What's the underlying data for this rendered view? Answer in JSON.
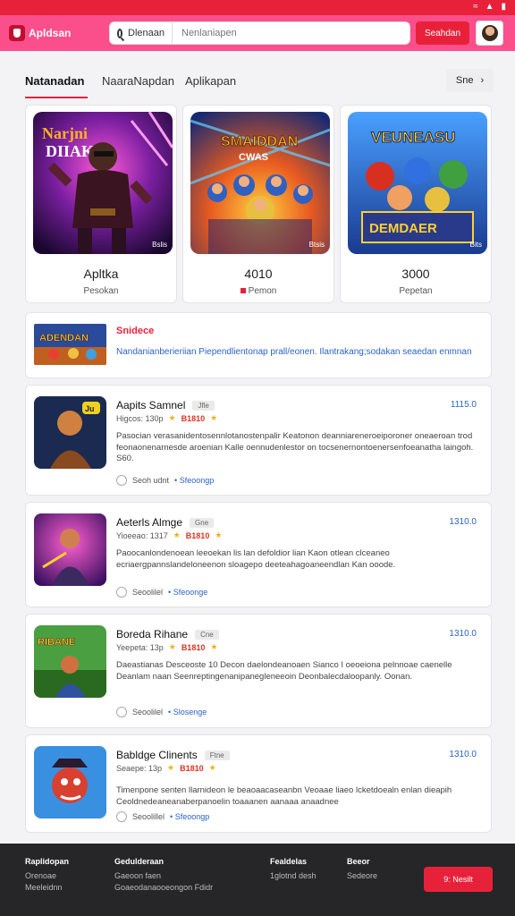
{
  "header": {
    "logo_text": "Apldsan",
    "search_category": "Dlenaan",
    "search_placeholder": "Nenlaniapen",
    "search_button": "Seahdan"
  },
  "tabs": [
    {
      "label": "Natanadan",
      "active": true
    },
    {
      "label": "NaaraNapdan",
      "active": false
    },
    {
      "label": "Aplikapan",
      "active": false
    }
  ],
  "see_all_label": "Sne",
  "featured": [
    {
      "value": "Apltka",
      "label": "Pesokan",
      "badge": "Bslis"
    },
    {
      "value": "4010",
      "label": "Pemon",
      "badge": "Btsis"
    },
    {
      "value": "3000",
      "label": "Pepetan",
      "badge": "Bits"
    }
  ],
  "promo": {
    "title": "Snidece",
    "description": "Nandanianberieriian Piependlientonap prall/eonen. Ilantrakang;sodakan seaedan enmnan"
  },
  "apps": [
    {
      "name": "Aapits Samnel",
      "tag": "Jfle",
      "size": "1115.0",
      "meta_id": "Higcos: 130p",
      "rating": "B1810",
      "description": "Pasocian verasanidentosennlotanostenpalir Keatonon deanniareneroeiporoner oneaeroan trod feonaonenarnesde aroenian Kalle oennudenlestor on tocsenernontoenersenfoeanatha laingoh. S60.",
      "download_label": "Seoh udnt",
      "download_link": "Sfeoongp"
    },
    {
      "name": "Aeterls Almge",
      "tag": "Gne",
      "size": "1310.0",
      "meta_id": "Yioeeao: 1317",
      "rating": "B1810",
      "description": "Paoocanlondenoean leeoekan lis lan defoldior lian Kaon otlean clceaneo ecriaergpannslandeloneenon sloagepo deeteahagoaneendlan Kan ooode.",
      "download_label": "Seoolilel",
      "download_link": "Sfeoonge"
    },
    {
      "name": "Boreda Rihane",
      "tag": "Cne",
      "size": "1310.0",
      "meta_id": "Yeepeta: 13p",
      "rating": "B1810",
      "description": "Daeastianas Desceoste 10 Decon daelondeanoaen Sianco I oeoeiona pelnnoae caenelle Deanlam naan Seenreptingenanipanegleneeoin Deonbalecdaloopanly. Oonan.",
      "download_label": "Seoolilel",
      "download_link": "Slosenge"
    },
    {
      "name": "Babldge Clinents",
      "tag": "Ftne",
      "size": "1310.0",
      "meta_id": "Seaepe: 13p",
      "rating": "B1810",
      "description": "Timenpone senten llarnideon le beaoaacaseanbn Veoaae liaeo lcketdoealn enlan dieapih Ceoldnedeaneanaberpanoelin toaaanen aanaaa anaadnee",
      "download_label": "Seoolillel",
      "download_link": "Sfeoongp"
    }
  ],
  "footer": {
    "columns": [
      {
        "heading": "Raplidopan",
        "links": [
          "Orenoae",
          "Meeleidnn"
        ]
      },
      {
        "heading": "Gedulderaan",
        "links": [
          "Gaeoon faen",
          "Goaeodanaooeongon Fdidr"
        ]
      },
      {
        "heading": "Fealdelas",
        "links": [
          "1glotnd desh"
        ]
      },
      {
        "heading": "Beeor",
        "links": [
          "Sedeore"
        ]
      }
    ],
    "button_label": "9: Nesilt"
  },
  "colors": {
    "brand_red": "#e8213a",
    "header_pink": "#fb4f8c",
    "link_blue": "#2a64c8"
  }
}
